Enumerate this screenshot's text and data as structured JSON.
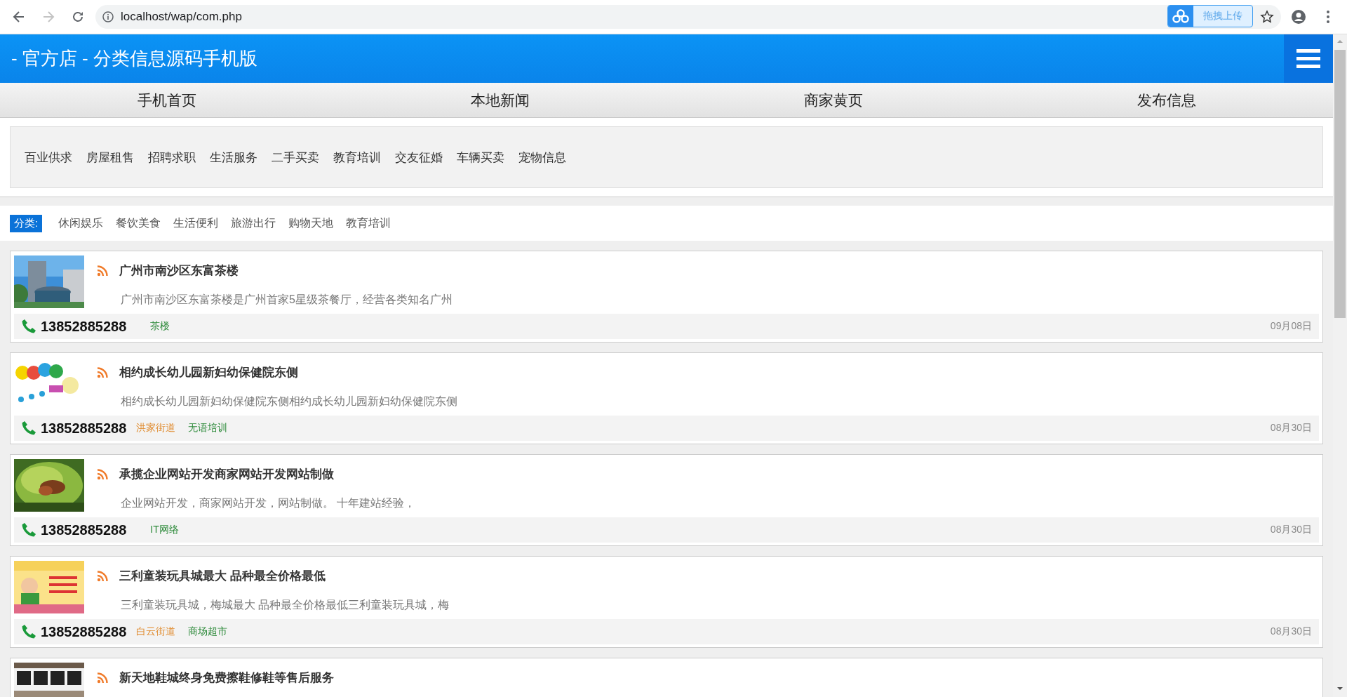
{
  "browser": {
    "back": {
      "disabled": false
    },
    "forward": {
      "disabled": true
    },
    "address": "localhost/wap/com.php",
    "extension_label": "拖拽上传"
  },
  "header": {
    "title": "- 官方店 - 分类信息源码手机版"
  },
  "nav": [
    "手机首页",
    "本地新闻",
    "商家黄页",
    "发布信息"
  ],
  "categories": [
    "百业供求",
    "房屋租售",
    "招聘求职",
    "生活服务",
    "二手买卖",
    "教育培训",
    "交友征婚",
    "车辆买卖",
    "宠物信息"
  ],
  "filter": {
    "label": "分类:",
    "items": [
      "休闲娱乐",
      "餐饮美食",
      "生活便利",
      "旅游出行",
      "购物天地",
      "教育培训"
    ]
  },
  "listings": [
    {
      "title": "广州市南沙区东富茶楼",
      "description": "广州市南沙区东富茶楼是广州首家5星级茶餐厅，经营各类知名广州",
      "phone": "13852885288",
      "tags": [
        {
          "kind": "category",
          "text": "茶楼"
        }
      ],
      "date": "09月08日"
    },
    {
      "title": "相约成长幼儿园新妇幼保健院东侧",
      "description": "相约成长幼儿园新妇幼保健院东侧相约成长幼儿园新妇幼保健院东侧",
      "phone": "13852885288",
      "tags": [
        {
          "kind": "area",
          "text": "洪家街道"
        },
        {
          "kind": "category",
          "text": "无语培训"
        }
      ],
      "date": "08月30日"
    },
    {
      "title": "承揽企业网站开发商家网站开发网站制做",
      "description": "企业网站开发，商家网站开发，网站制做。 十年建站经验，",
      "phone": "13852885288",
      "tags": [
        {
          "kind": "category",
          "text": "IT网络"
        }
      ],
      "date": "08月30日"
    },
    {
      "title": "三利童装玩具城最大 品种最全价格最低",
      "description": "三利童装玩具城，梅城最大 品种最全价格最低三利童装玩具城，梅",
      "phone": "13852885288",
      "tags": [
        {
          "kind": "area",
          "text": "白云街道"
        },
        {
          "kind": "category",
          "text": "商场超市"
        }
      ],
      "date": "08月30日"
    },
    {
      "title": "新天地鞋城终身免费擦鞋修鞋等售后服务"
    }
  ]
}
